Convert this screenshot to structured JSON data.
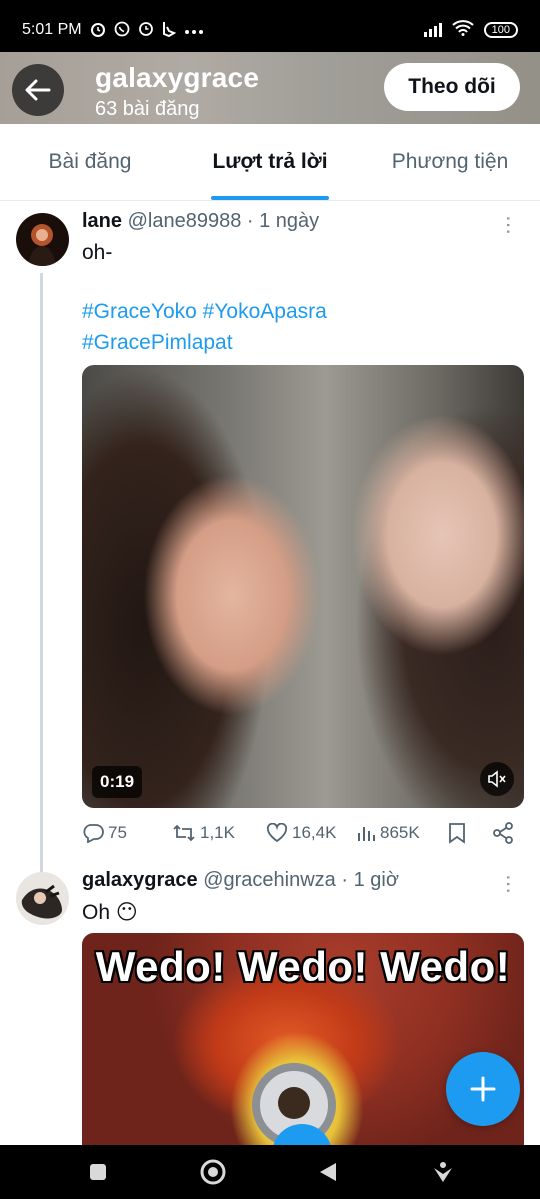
{
  "status_bar": {
    "time": "5:01 PM",
    "notification_icons": [
      "alarm-clock-icon",
      "whatsapp-icon",
      "alarm-icon",
      "bing-icon",
      "more-icon"
    ],
    "battery": "100"
  },
  "profile_header": {
    "name": "galaxygrace",
    "post_count": "63 bài đăng",
    "follow_label": "Theo dõi"
  },
  "tabs": [
    {
      "label": "Bài đăng",
      "active": false
    },
    {
      "label": "Lượt trả lời",
      "active": true
    },
    {
      "label": "Phương tiện",
      "active": false
    }
  ],
  "tweets": [
    {
      "name": "lane",
      "handle": "@lane89988",
      "time": "· 1 ngày",
      "text": "oh-",
      "hashtags_line1": "#GraceYoko #YokoApasra",
      "hashtags_line2": "#GracePimlapat",
      "media": {
        "type": "video",
        "duration": "0:19"
      },
      "stats": {
        "replies": "75",
        "retweets": "1,1K",
        "likes": "16,4K",
        "views": "865K"
      }
    },
    {
      "name": "galaxygrace",
      "handle": "@gracehinwza",
      "time": "· 1 giờ",
      "text": "Oh 😶",
      "media": {
        "type": "gif",
        "caption": "Wedo! Wedo! Wedo!"
      }
    }
  ],
  "colors": {
    "accent": "#1d9bf0",
    "secondary_text": "#536471",
    "primary_text": "#0f1419"
  }
}
